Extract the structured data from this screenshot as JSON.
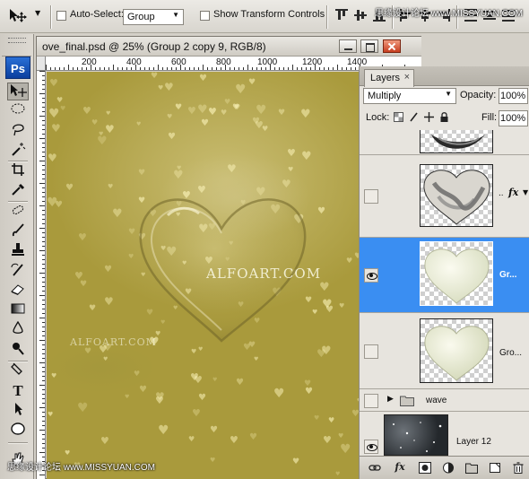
{
  "options_bar": {
    "auto_select_label": "Auto-Select:",
    "auto_select_value": "Group",
    "show_transform_label": "Show Transform Controls"
  },
  "watermarks": {
    "site_top": "思缘设计论坛 www.MISSYUAN.COM",
    "site_bottom": "思缘设计论坛 www.MISSYUAN.COM",
    "canvas_main": "ALFOART.COM",
    "canvas_secondary": "ALFOART.COM"
  },
  "tools": {
    "logo": "Ps",
    "items": [
      "move-tool",
      "elliptical-marquee-tool",
      "lasso-tool",
      "magic-wand-tool",
      "crop-tool",
      "eyedropper-tool",
      "spot-healing-tool",
      "brush-tool",
      "clone-stamp-tool",
      "history-brush-tool",
      "eraser-tool",
      "gradient-tool",
      "blur-tool",
      "dodge-tool",
      "pen-tool",
      "type-tool",
      "path-selection-tool",
      "ellipse-tool"
    ]
  },
  "document": {
    "title": "ove_final.psd @ 25% (Group 2 copy 9, RGB/8)",
    "ruler_labels": [
      "200",
      "400",
      "600",
      "800",
      "1000",
      "1200",
      "1400"
    ]
  },
  "layers_panel": {
    "tab_label": "Layers",
    "blend_mode": "Multiply",
    "opacity_label": "Opacity:",
    "opacity_value": "100%",
    "lock_label": "Lock:",
    "fill_label": "Fill:",
    "fill_value": "100%",
    "layers": [
      {
        "name": "",
        "visible": false,
        "selected": false,
        "fx": false
      },
      {
        "name": "..",
        "visible": false,
        "selected": false,
        "fx": true
      },
      {
        "name": "Gr...",
        "visible": true,
        "selected": true,
        "fx": false
      },
      {
        "name": "Gro...",
        "visible": false,
        "selected": false,
        "fx": false
      },
      {
        "name": "wave",
        "visible": false,
        "selected": false,
        "fx": false,
        "group": true
      },
      {
        "name": "Layer 12",
        "visible": true,
        "selected": false,
        "fx": false
      }
    ],
    "fx_text": "fx",
    "footer_icons": [
      "link-icon",
      "fx-icon",
      "mask-icon",
      "adjustment-icon",
      "new-group-icon",
      "new-layer-icon",
      "trash-icon"
    ]
  },
  "colors": {
    "selection": "#3a8ef2",
    "canvas_gold": "#b3a346",
    "panel_bg": "#e7e4de",
    "chrome": "#d4d0c8"
  }
}
